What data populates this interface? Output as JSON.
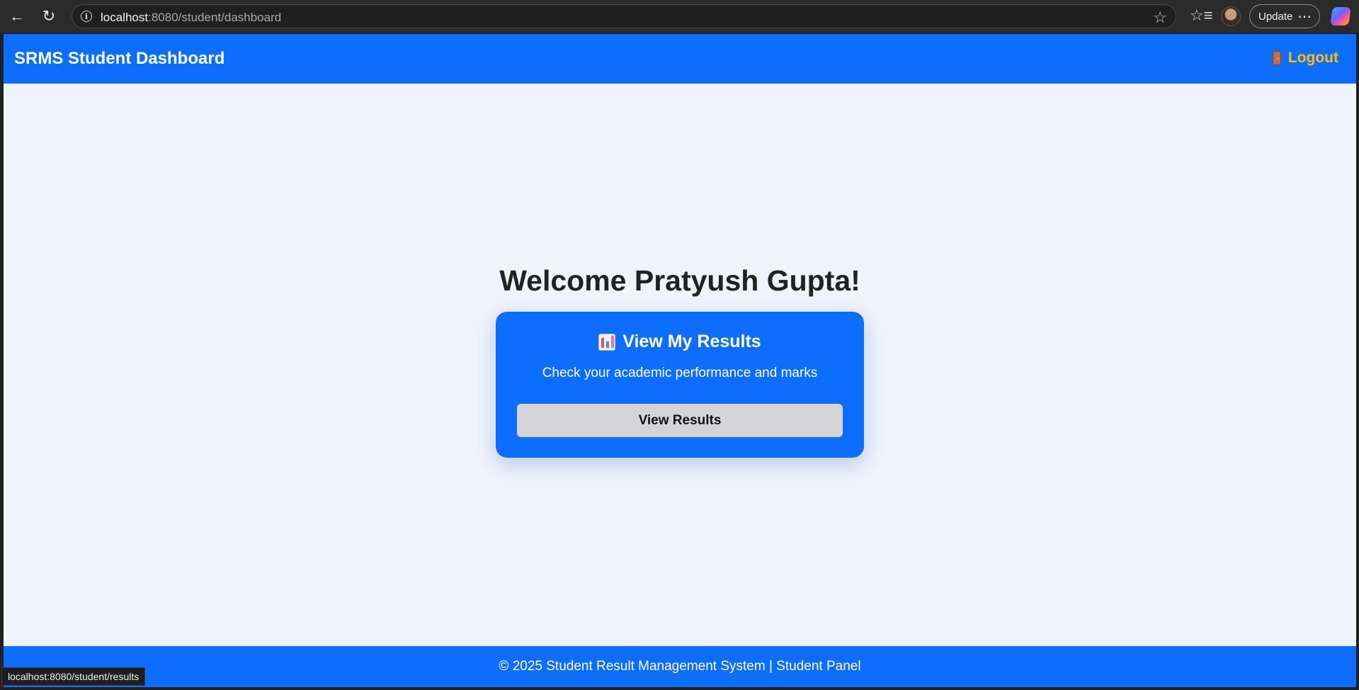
{
  "browser": {
    "url_host": "localhost",
    "url_path": ":8080/student/dashboard",
    "update_label": "Update",
    "status_url": "localhost:8080/student/results"
  },
  "header": {
    "brand": "SRMS Student Dashboard",
    "logout_label": "Logout"
  },
  "main": {
    "welcome": "Welcome Pratyush Gupta!",
    "card": {
      "title": "View My Results",
      "subtitle": "Check your academic performance and marks",
      "button_label": "View Results"
    }
  },
  "footer": {
    "text": "© 2025 Student Result Management System | Student Panel"
  },
  "colors": {
    "primary": "#0d6efd",
    "accent": "#ffc107",
    "page_bg": "#eef3fc"
  }
}
